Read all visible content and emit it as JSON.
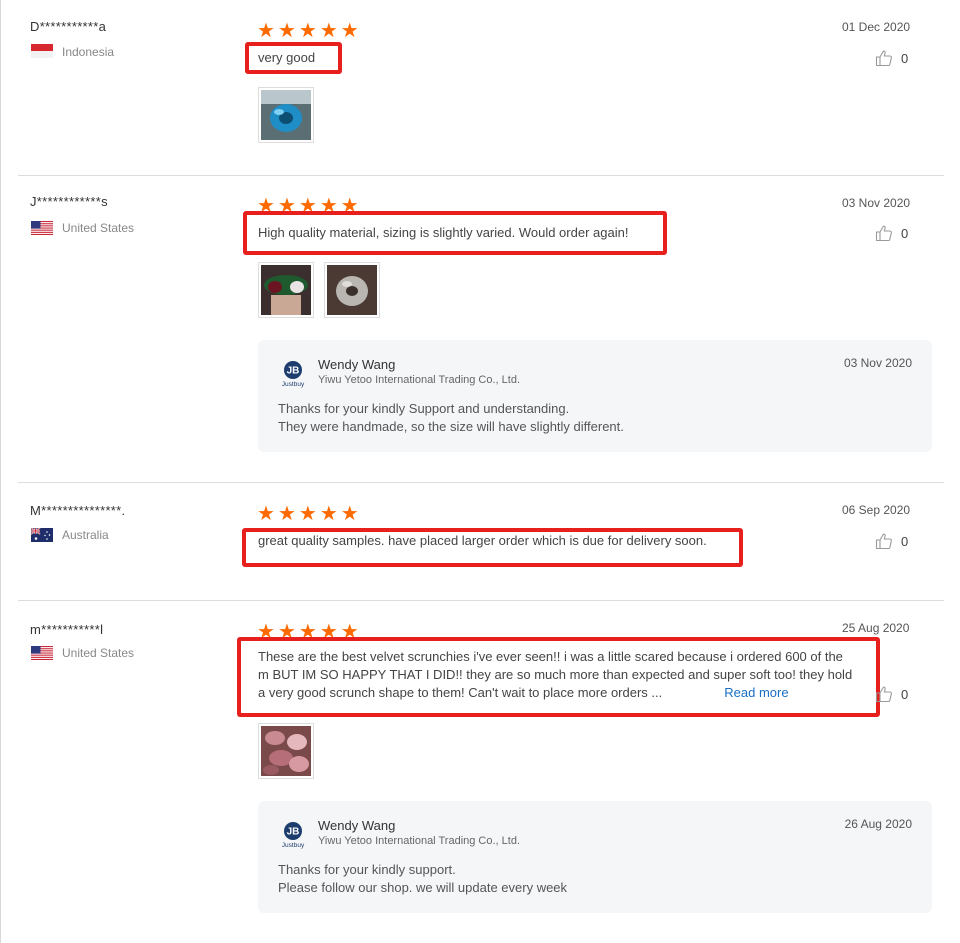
{
  "reviews": [
    {
      "reviewer": "D***********a",
      "country": "Indonesia",
      "stars": 5,
      "date": "01 Dec 2020",
      "helpful_count": "0",
      "text": "very good",
      "images": [
        "teal scrunchie photo"
      ]
    },
    {
      "reviewer": "J************s",
      "country": "United States",
      "stars": 5,
      "date": "03 Nov 2020",
      "helpful_count": "0",
      "text": "High quality material, sizing is slightly varied. Would order again!",
      "images": [
        "velvet scrunchies photo",
        "grey scrunchie photo"
      ],
      "reply": {
        "name": "Wendy Wang",
        "company": "Yiwu Yetoo International Trading Co., Ltd.",
        "date": "03 Nov 2020",
        "lines": [
          "Thanks for your kindly Support and understanding.",
          "They were handmade, so the size will have slightly different."
        ]
      }
    },
    {
      "reviewer": "M***************.",
      "country": "Australia",
      "stars": 5,
      "date": "06 Sep 2020",
      "helpful_count": "0",
      "text": "great quality samples. have placed larger order which is due for delivery soon."
    },
    {
      "reviewer": "m***********l",
      "country": "United States",
      "stars": 5,
      "date": "25 Aug 2020",
      "helpful_count": "0",
      "text_lines": [
        "These are the best velvet scrunchies i've ever seen!! i was a little scared because i ordered 600 of the",
        "m BUT IM SO HAPPY THAT I DID!! they are so much more than expected and super soft too! they hold",
        "a very good scrunch shape to them! Can't wait to place more orders ..."
      ],
      "read_more": "Read more",
      "images": [
        "pink scrunchies photo"
      ],
      "reply": {
        "name": "Wendy Wang",
        "company": "Yiwu Yetoo International Trading Co., Ltd.",
        "date": "26 Aug 2020",
        "lines": [
          "Thanks for your kindly support.",
          "Please follow our shop. we will update every week"
        ]
      }
    }
  ],
  "seller_logo_text": "JB",
  "seller_logo_sub": "Justbuy",
  "colors": {
    "star": "#ff6a00",
    "highlight_box": "#e8201d",
    "link": "#1a6fc4",
    "reply_bg": "#f5f6f8"
  },
  "icons": {
    "helpful": "thumbs-up-icon",
    "star": "star-icon"
  }
}
